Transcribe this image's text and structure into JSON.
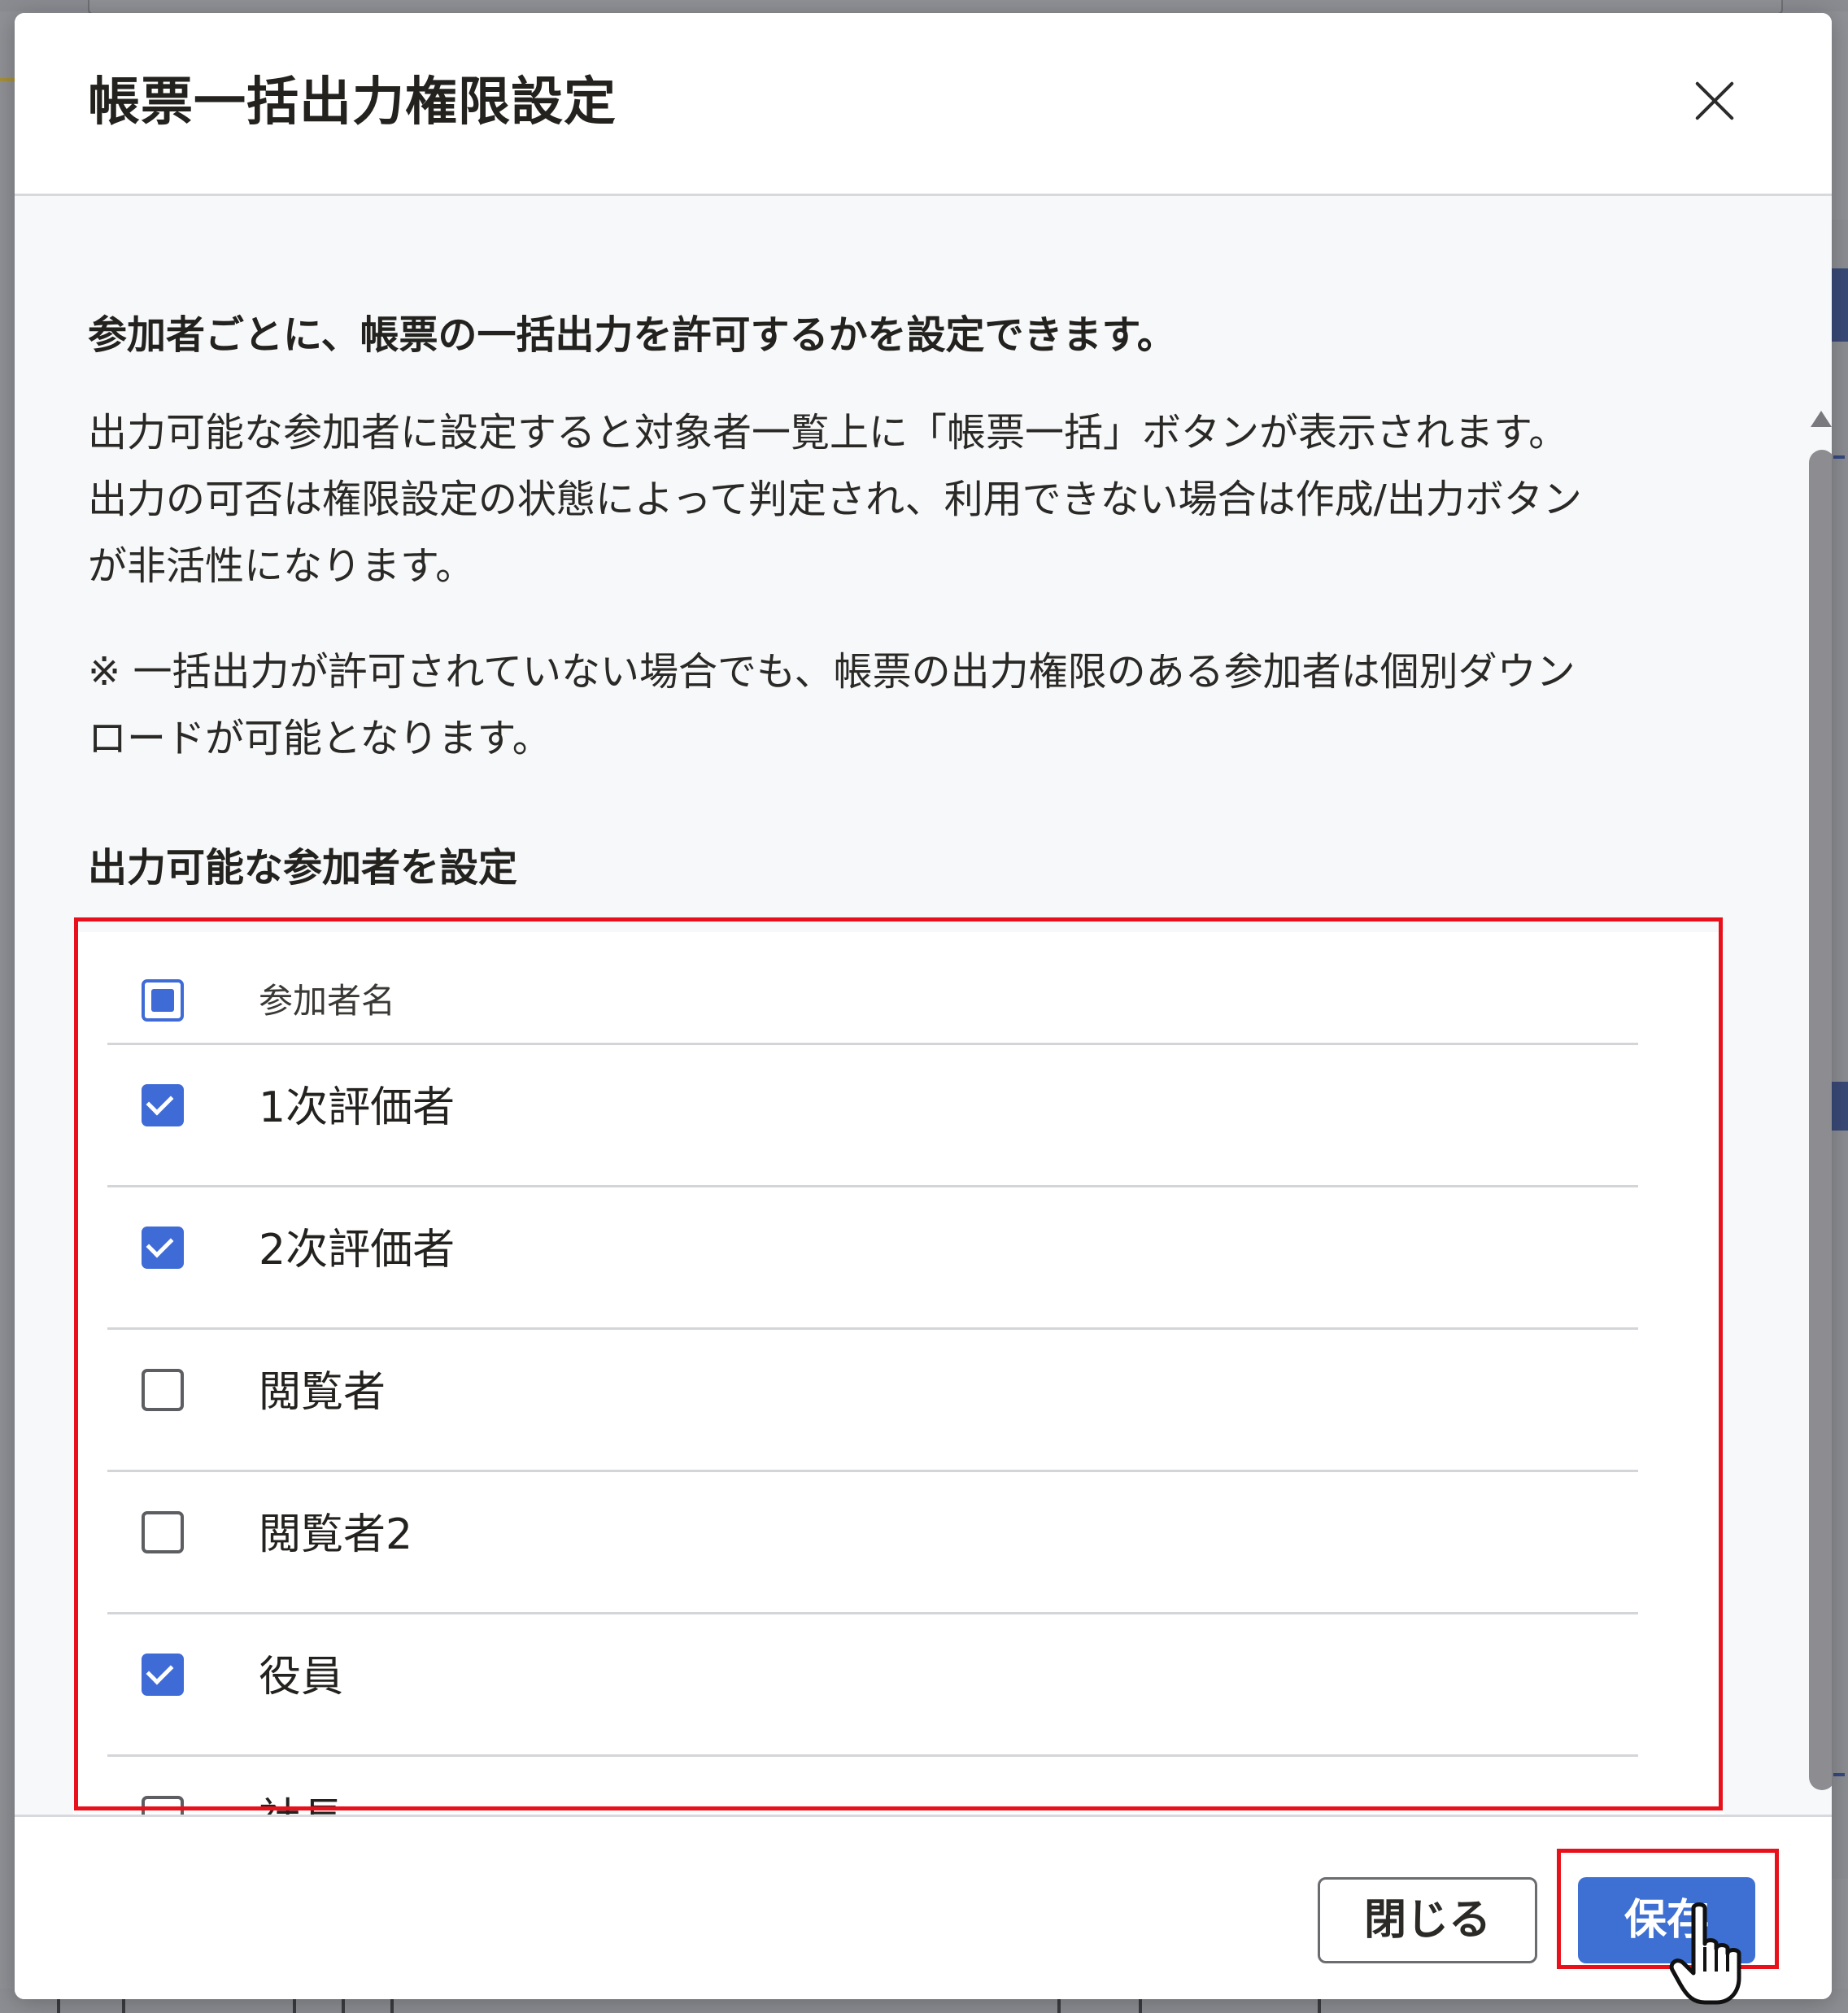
{
  "dialog": {
    "title": "帳票一括出力権限設定",
    "lead": "参加者ごとに、帳票の一括出力を許可するかを設定できます。",
    "paragraph1": "出力可能な参加者に設定すると対象者一覧上に「帳票一括」ボタンが表示されます。\n出力の可否は権限設定の状態によって判定され、利用できない場合は作成/出力ボタン\nが非活性になります。",
    "paragraph2": "※ 一括出力が許可されていない場合でも、帳票の出力権限のある参加者は個別ダウン\nロードが可能となります。",
    "section_title": "出力可能な参加者を設定",
    "list": {
      "header_label": "参加者名",
      "select_all_state": "indeterminate",
      "rows": [
        {
          "label": "1次評価者",
          "checked": true
        },
        {
          "label": "2次評価者",
          "checked": true
        },
        {
          "label": "閲覧者",
          "checked": false
        },
        {
          "label": "閲覧者2",
          "checked": false
        },
        {
          "label": "役員",
          "checked": true
        },
        {
          "label": "社長",
          "checked": false
        }
      ]
    },
    "buttons": {
      "close": "閉じる",
      "save": "保存"
    },
    "icons": {
      "close": "close-icon",
      "cursor": "hand-pointer-icon"
    },
    "colors": {
      "accent": "#3e6fd3",
      "highlight": "#e8111b"
    }
  }
}
